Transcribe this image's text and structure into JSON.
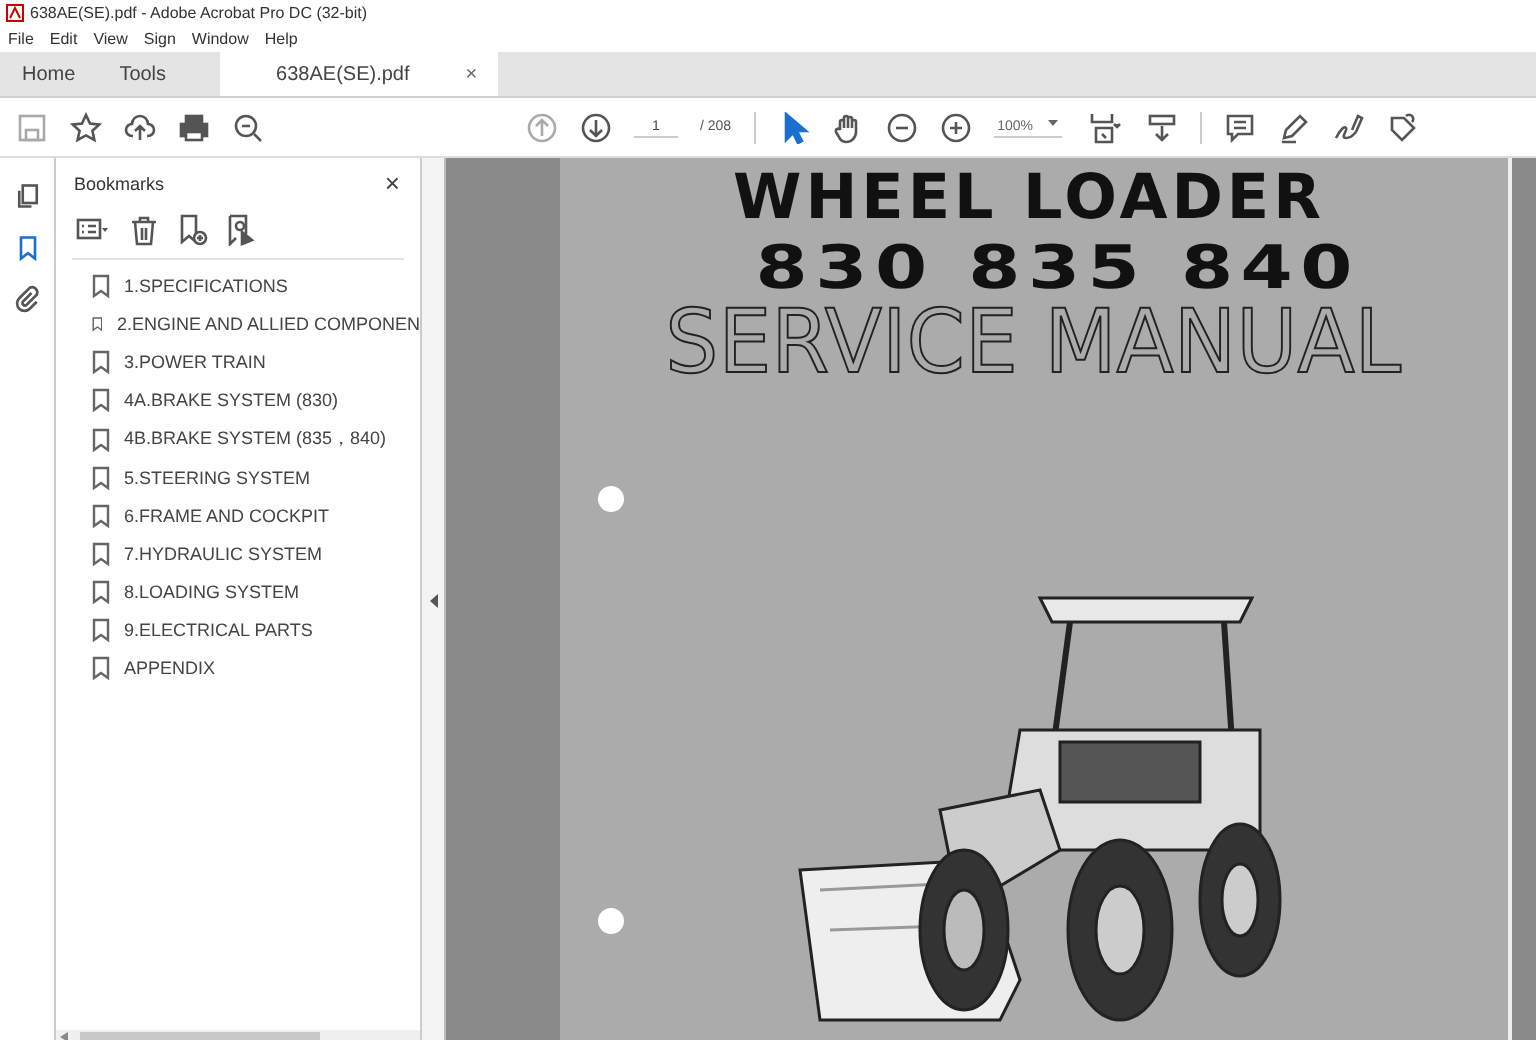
{
  "window": {
    "title": "638AE(SE).pdf - Adobe Acrobat Pro DC (32-bit)"
  },
  "menu": [
    "File",
    "Edit",
    "View",
    "Sign",
    "Window",
    "Help"
  ],
  "tabs": [
    {
      "label": "Home",
      "selected": false
    },
    {
      "label": "Tools",
      "selected": false
    },
    {
      "label": "638AE(SE).pdf",
      "selected": true,
      "close": "×"
    }
  ],
  "toolbar": {
    "page": "1",
    "total": "/ 208",
    "zoom": "100%"
  },
  "side_strip": [
    {
      "kind": "pages",
      "selected": false
    },
    {
      "kind": "bookmarks",
      "selected": true
    },
    {
      "kind": "attachments",
      "selected": false
    }
  ],
  "bookmarks": {
    "title": "Bookmarks",
    "close": "×",
    "items": [
      {
        "label": "1.SPECIFICATIONS"
      },
      {
        "label": "2.ENGINE AND ALLIED COMPONEN"
      },
      {
        "label": "3.POWER TRAIN"
      },
      {
        "label": "4A.BRAKE SYSTEM (830)"
      },
      {
        "label": "4B.BRAKE SYSTEM (835，840)"
      },
      {
        "label": "5.STEERING SYSTEM"
      },
      {
        "label": "6.FRAME AND COCKPIT"
      },
      {
        "label": "7.HYDRAULIC SYSTEM"
      },
      {
        "label": "8.LOADING SYSTEM"
      },
      {
        "label": "9.ELECTRICAL PARTS"
      },
      {
        "label": "APPENDIX"
      }
    ]
  },
  "document": {
    "heading": "WHEEL LOADER",
    "models": "830 835 840",
    "subtitle": "SERVICE MANUAL"
  }
}
